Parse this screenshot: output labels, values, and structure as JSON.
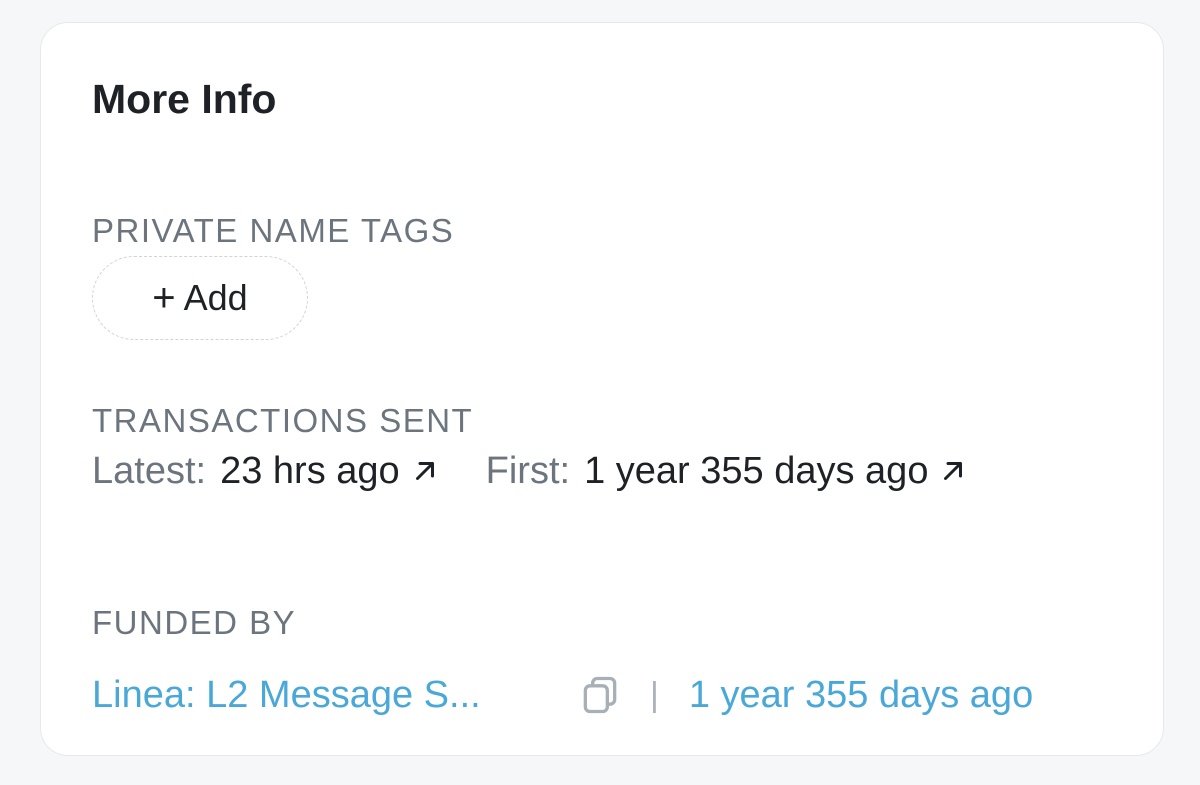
{
  "card": {
    "title": "More Info"
  },
  "private_name_tags": {
    "label": "PRIVATE NAME TAGS",
    "add_label": "Add"
  },
  "transactions_sent": {
    "label": "TRANSACTIONS SENT",
    "latest_key": "Latest:",
    "latest_value": "23 hrs ago",
    "first_key": "First:",
    "first_value": "1 year 355 days ago"
  },
  "funded_by": {
    "label": "FUNDED BY",
    "funder": "Linea: L2 Message S...",
    "divider": "|",
    "time": "1 year 355 days ago"
  },
  "colors": {
    "page_bg": "#f6f7f9",
    "card_bg": "#ffffff",
    "text_primary": "#1e2227",
    "text_muted": "#6c757d",
    "link": "#4aa8d8"
  },
  "icons": {
    "plus": "plus-icon",
    "external_link": "arrow-up-right-icon",
    "copy": "copy-icon"
  }
}
